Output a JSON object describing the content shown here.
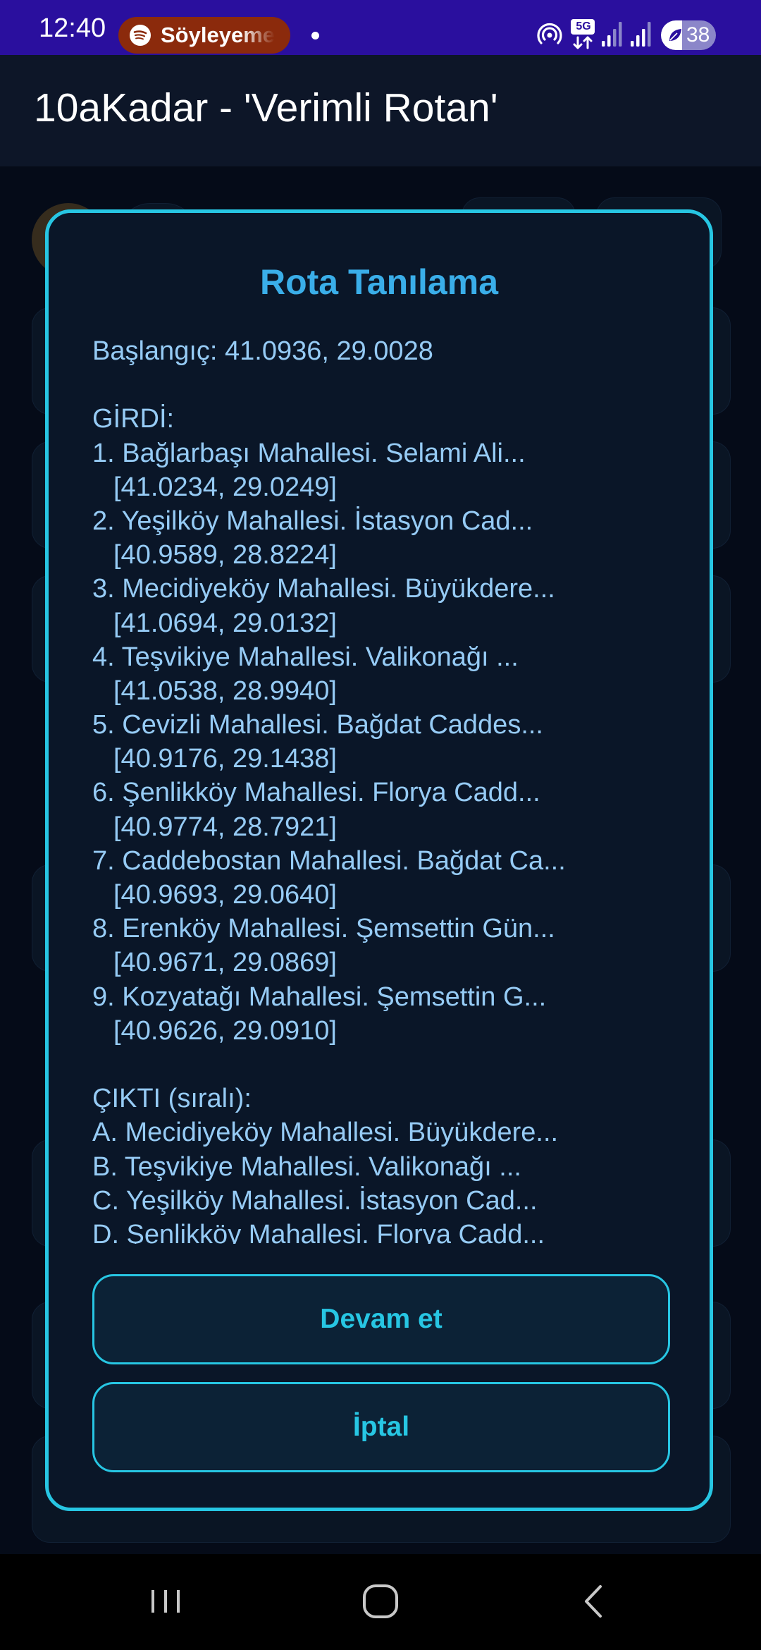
{
  "status_bar": {
    "time": "12:40",
    "media_app_label": "Söyleyeme",
    "network_label": "5G",
    "battery_level": "38",
    "battery_fraction": 0.38,
    "icons": [
      "spotify-icon",
      "hotspot-icon",
      "5g-data-icon",
      "signal-icon",
      "signal-icon",
      "battery-saver-icon"
    ]
  },
  "app_bar": {
    "title": "10aKadar - 'Verimli Rotan'"
  },
  "dialog": {
    "title": "Rota Tanılama",
    "start_line": "Başlangıç: 41.0936, 29.0028",
    "input_header": "GİRDİ:",
    "inputs": [
      {
        "name": "1. Bağlarbaşı Mahallesi. Selami Ali...",
        "coords": "[41.0234, 29.0249]"
      },
      {
        "name": "2. Yeşilköy Mahallesi. İstasyon Cad...",
        "coords": "[40.9589, 28.8224]"
      },
      {
        "name": "3. Mecidiyeköy Mahallesi. Büyükdere...",
        "coords": "[41.0694, 29.0132]"
      },
      {
        "name": "4. Teşvikiye Mahallesi. Valikonağı ...",
        "coords": "[41.0538, 28.9940]"
      },
      {
        "name": "5. Cevizli Mahallesi. Bağdat Caddes...",
        "coords": "[40.9176, 29.1438]"
      },
      {
        "name": "6. Şenlikköy Mahallesi. Florya Cadd...",
        "coords": "[40.9774, 28.7921]"
      },
      {
        "name": "7. Caddebostan Mahallesi. Bağdat Ca...",
        "coords": "[40.9693, 29.0640]"
      },
      {
        "name": "8. Erenköy Mahallesi. Şemsettin Gün...",
        "coords": "[40.9671, 29.0869]"
      },
      {
        "name": "9. Kozyatağı Mahallesi. Şemsettin G...",
        "coords": "[40.9626, 29.0910]"
      }
    ],
    "output_header": "ÇIKTI (sıralı):",
    "outputs": [
      "A. Mecidiyeköy Mahallesi. Büyükdere...",
      "B. Teşvikiye Mahallesi. Valikonağı ...",
      "C. Yeşilköy Mahallesi. İstasyon Cad...",
      "D. Şenlikköy Mahallesi. Florya Cadd..."
    ],
    "continue_label": "Devam et",
    "cancel_label": "İptal"
  },
  "nav_bar": {
    "buttons": [
      "recents-icon",
      "home-icon",
      "back-icon"
    ]
  },
  "colors": {
    "status_bar_bg": "#2a0f9e",
    "accent": "#27c6e3",
    "title_blue": "#3aaee9",
    "body_text": "#96cbf5",
    "dialog_bg": "#0a1628"
  }
}
